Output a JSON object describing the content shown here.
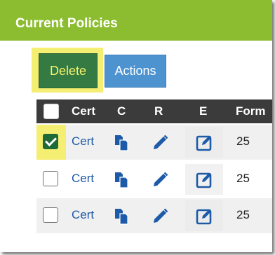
{
  "panel": {
    "title": "Current Policies"
  },
  "toolbar": {
    "delete_label": "Delete",
    "actions_label": "Actions"
  },
  "table": {
    "columns": [
      "Cert",
      "C",
      "R",
      "E",
      "Form"
    ],
    "rows": [
      {
        "checked": true,
        "cert": "Cert",
        "form": "25"
      },
      {
        "checked": false,
        "cert": "Cert",
        "form": "25"
      },
      {
        "checked": false,
        "cert": "Cert",
        "form": "25"
      }
    ]
  },
  "icons": {
    "copy": "copy-icon",
    "renew": "pencil-icon",
    "edit": "edit-square-icon"
  },
  "colors": {
    "header_bg": "#8cbc2f",
    "delete_bg": "#347a42",
    "delete_text": "#f7f26b",
    "actions_bg": "#4d93d0",
    "highlight": "#f4ee72",
    "table_head_bg": "#3b3b3b",
    "link": "#1d5aa7",
    "icon": "#1d5aa7"
  }
}
